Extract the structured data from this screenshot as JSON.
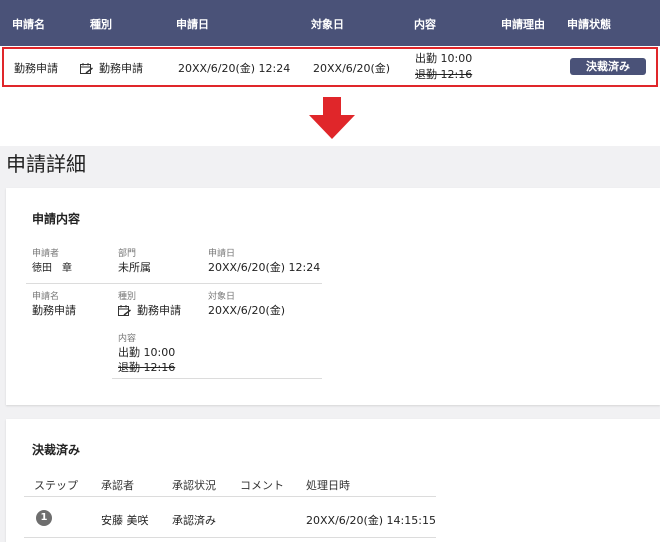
{
  "list": {
    "headers": [
      "申請名",
      "種別",
      "申請日",
      "対象日",
      "内容",
      "申請理由",
      "申請状態"
    ],
    "row": {
      "name": "勤務申請",
      "type": "勤務申請",
      "applied_date": "20XX/6/20(金) 12:24",
      "target_date": "20XX/6/20(金)",
      "content_line1": "出勤 10:00",
      "content_line2": "退勤 12:16",
      "reason": "",
      "status": "決裁済み"
    }
  },
  "detail": {
    "page_title": "申請詳細",
    "content_card": {
      "title": "申請内容",
      "fields": {
        "applicant_label": "申請者",
        "applicant_value": "徳田　章",
        "department_label": "部門",
        "department_value": "未所属",
        "applied_date_label": "申請日",
        "applied_date_value": "20XX/6/20(金) 12:24",
        "name_label": "申請名",
        "name_value": "勤務申請",
        "type_label": "種別",
        "type_value": "勤務申請",
        "target_date_label": "対象日",
        "target_date_value": "20XX/6/20(金)",
        "content_label": "内容",
        "content_line1": "出勤 10:00",
        "content_line2": "退勤 12:16"
      }
    },
    "decided_card": {
      "title": "決裁済み",
      "columns": [
        "ステップ",
        "承認者",
        "承認状況",
        "コメント",
        "処理日時"
      ],
      "rows": [
        {
          "step": "1",
          "approver": "安藤 美咲",
          "status": "承認済み",
          "comment": "",
          "processed_at": "20XX/6/20(金) 14:15:15"
        }
      ]
    }
  },
  "colors": {
    "header_bg": "#4a5278",
    "highlight_border": "#e0262a",
    "arrow": "#e0262a",
    "detail_bg": "#f1f1f3"
  },
  "icons": {
    "application_type": "calendar-edit-icon",
    "arrow": "arrow-down-icon",
    "step": "step-number-icon"
  }
}
